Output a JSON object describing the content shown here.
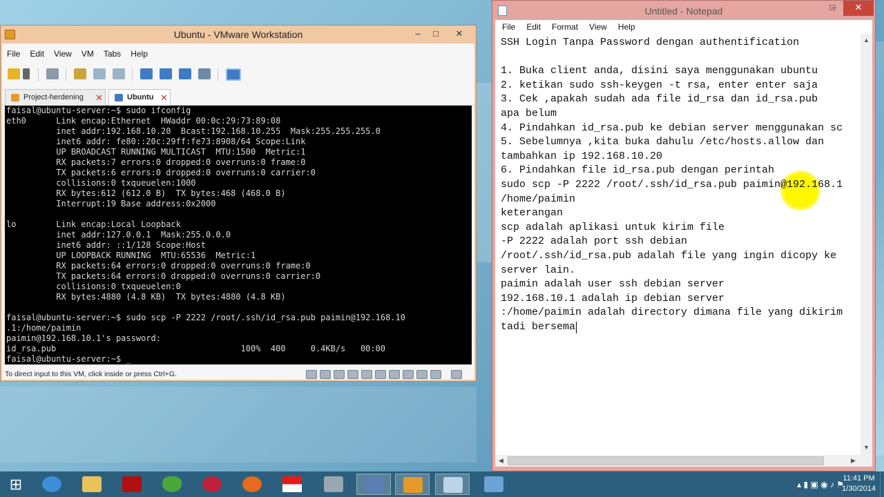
{
  "vmware": {
    "title": "Ubuntu - VMware Workstation",
    "controls": {
      "minimize": "–",
      "maximize": "□",
      "close": "✕"
    },
    "menu": [
      "File",
      "Edit",
      "View",
      "VM",
      "Tabs",
      "Help"
    ],
    "tabs": [
      {
        "label": "Project-herdening",
        "active": false
      },
      {
        "label": "Ubuntu",
        "active": true
      }
    ],
    "tab_close": "✕",
    "console_lines": [
      "faisal@ubuntu-server:~$ sudo ifconfig",
      "eth0      Link encap:Ethernet  HWaddr 00:0c:29:73:89:08",
      "          inet addr:192.168.10.20  Bcast:192.168.10.255  Mask:255.255.255.0",
      "          inet6 addr: fe80::20c:29ff:fe73:8908/64 Scope:Link",
      "          UP BROADCAST RUNNING MULTICAST  MTU:1500  Metric:1",
      "          RX packets:7 errors:0 dropped:0 overruns:0 frame:0",
      "          TX packets:6 errors:0 dropped:0 overruns:0 carrier:0",
      "          collisions:0 txqueuelen:1000",
      "          RX bytes:612 (612.0 B)  TX bytes:468 (468.0 B)",
      "          Interrupt:19 Base address:0x2000",
      "",
      "lo        Link encap:Local Loopback",
      "          inet addr:127.0.0.1  Mask:255.0.0.0",
      "          inet6 addr: ::1/128 Scope:Host",
      "          UP LOOPBACK RUNNING  MTU:65536  Metric:1",
      "          RX packets:64 errors:0 dropped:0 overruns:0 frame:0",
      "          TX packets:64 errors:0 dropped:0 overruns:0 carrier:0",
      "          collisions:0 txqueuelen:0",
      "          RX bytes:4880 (4.8 KB)  TX bytes:4880 (4.8 KB)",
      "",
      "faisal@ubuntu-server:~$ sudo scp -P 2222 /root/.ssh/id_rsa.pub paimin@192.168.10",
      ".1:/home/paimin",
      "paimin@192.168.10.1's password:",
      "id_rsa.pub                                     100%  400     0.4KB/s   00:00",
      "faisal@ubuntu-server:~$ _"
    ],
    "status_text": "To direct input to this VM, click inside or press Ctrl+G."
  },
  "notepad": {
    "title": "Untitled - Notepad",
    "controls": {
      "minimize": "–",
      "maximize": "□",
      "close": "✕"
    },
    "menu": [
      "File",
      "Edit",
      "Format",
      "View",
      "Help"
    ],
    "lines": [
      "SSH Login Tanpa Password dengan authentification",
      "",
      "1. Buka client anda, disini saya menggunakan ubuntu",
      "2. ketikan sudo ssh-keygen -t rsa, enter enter saja",
      "3. Cek ,apakah sudah ada file id_rsa dan id_rsa.pub",
      "apa belum",
      "4. Pindahkan id_rsa.pub ke debian server menggunakan sc",
      "5. Sebelumnya ,kita buka dahulu /etc/hosts.allow dan",
      "tambahkan ip 192.168.10.20",
      "6. Pindahkan file id_rsa.pub dengan perintah",
      "sudo scp -P 2222 /root/.ssh/id_rsa.pub paimin@192.168.1",
      "/home/paimin",
      "keterangan",
      "scp adalah aplikasi untuk kirim file",
      "-P 2222 adalah port ssh debian",
      "/root/.ssh/id_rsa.pub adalah file yang ingin dicopy ke",
      "server lain.",
      "paimin adalah user ssh debian server",
      "192.168.10.1 adalah ip debian server",
      ":/home/paimin adalah directory dimana file yang dikirim",
      "tadi bersema"
    ],
    "scroll": {
      "up": "▲",
      "down": "▼",
      "left": "◀",
      "right": "▶"
    }
  },
  "taskbar": {
    "start_glyph": "⊞",
    "apps": [
      {
        "icon": "internet-explorer-icon",
        "color": "#3b8fd9"
      },
      {
        "icon": "file-explorer-icon",
        "color": "#e8c25a"
      },
      {
        "icon": "red-hand-app-icon",
        "color": "#b01010"
      },
      {
        "icon": "green-shield-icon",
        "color": "#4aa83a"
      },
      {
        "icon": "media-app-icon",
        "color": "#c0203a"
      },
      {
        "icon": "firefox-icon",
        "color": "#e86a1c"
      },
      {
        "icon": "indonesia-flag-icon",
        "color": "#e21b1b"
      },
      {
        "icon": "network-app-icon",
        "color": "#9aa6b2"
      },
      {
        "icon": "network-connect-icon",
        "color": "#5a7fb5"
      },
      {
        "icon": "vmware-taskbar-icon",
        "color": "#e39a2a"
      },
      {
        "icon": "notepad-taskbar-icon",
        "color": "#bcd4e6"
      },
      {
        "icon": "remote-desktop-icon",
        "color": "#6aa3d4"
      }
    ],
    "tray_glyphs": "▴ ▮ ▣ ◉ ♪ ⚑",
    "time": "11:41 PM",
    "date": "1/30/2014"
  }
}
